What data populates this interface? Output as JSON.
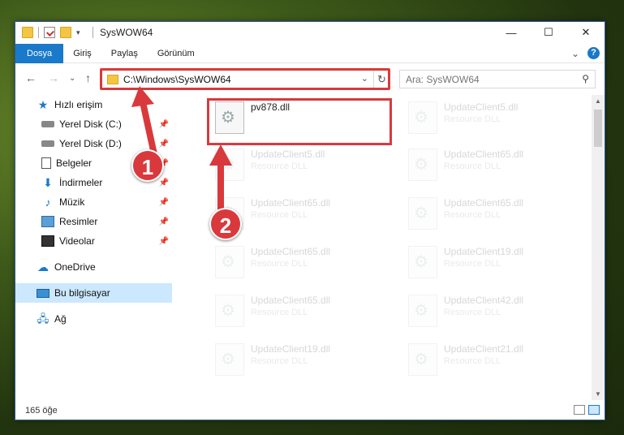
{
  "window": {
    "title": "SysWOW64"
  },
  "controls": {
    "minimize": "—",
    "maximize": "☐",
    "close": "✕"
  },
  "ribbon": {
    "tabs": [
      "Dosya",
      "Giriş",
      "Paylaş",
      "Görünüm"
    ],
    "expand": "⌄",
    "help": "?"
  },
  "navigation": {
    "back": "←",
    "forward": "→",
    "recent": "⌄",
    "up": "↑"
  },
  "address": {
    "path": "C:\\Windows\\SysWOW64",
    "dropdown": "⌄",
    "refresh": "↻"
  },
  "search": {
    "placeholder": "Ara: SysWOW64",
    "icon": "⚲"
  },
  "sidebar": {
    "items": [
      {
        "label": "Hızlı erişim",
        "icon": "star-icon",
        "pinned": false
      },
      {
        "label": "Yerel Disk (C:)",
        "icon": "disk-icon",
        "pinned": true
      },
      {
        "label": "Yerel Disk (D:)",
        "icon": "disk-icon",
        "pinned": true
      },
      {
        "label": "Belgeler",
        "icon": "document-icon",
        "pinned": true
      },
      {
        "label": "İndirmeler",
        "icon": "download-icon",
        "pinned": true
      },
      {
        "label": "Müzik",
        "icon": "music-icon",
        "pinned": true
      },
      {
        "label": "Resimler",
        "icon": "pictures-icon",
        "pinned": true
      },
      {
        "label": "Videolar",
        "icon": "video-icon",
        "pinned": true
      },
      {
        "label": "OneDrive",
        "icon": "cloud-icon",
        "pinned": false
      },
      {
        "label": "Bu bilgisayar",
        "icon": "computer-icon",
        "pinned": false,
        "selected": true
      },
      {
        "label": "Ağ",
        "icon": "network-icon",
        "pinned": false
      }
    ],
    "pin_glyph": "📌"
  },
  "files": [
    {
      "name": "pv878.dll",
      "type": "",
      "faded": false
    },
    {
      "name": "UpdateClient5.dll",
      "type": "Resource DLL",
      "faded": true
    },
    {
      "name": "UpdateClient5.dll",
      "type": "Resource DLL",
      "faded": true
    },
    {
      "name": "UpdateClient65.dll",
      "type": "Resource DLL",
      "faded": true
    },
    {
      "name": "UpdateClient65.dll",
      "type": "Resource DLL",
      "faded": true
    },
    {
      "name": "UpdateClient65.dll",
      "type": "Resource DLL",
      "faded": true
    },
    {
      "name": "UpdateClient65.dll",
      "type": "Resource DLL",
      "faded": true
    },
    {
      "name": "UpdateClient19.dll",
      "type": "Resource DLL",
      "faded": true
    },
    {
      "name": "UpdateClient65.dll",
      "type": "Resource DLL",
      "faded": true
    },
    {
      "name": "UpdateClient42.dll",
      "type": "Resource DLL",
      "faded": true
    },
    {
      "name": "UpdateClient19.dll",
      "type": "Resource DLL",
      "faded": true
    },
    {
      "name": "UpdateClient21.dll",
      "type": "Resource DLL",
      "faded": true
    }
  ],
  "status": {
    "item_count": "165 öğe"
  },
  "callouts": [
    "1",
    "2"
  ],
  "colors": {
    "accent": "#1979ca",
    "highlight": "#d9393c"
  }
}
